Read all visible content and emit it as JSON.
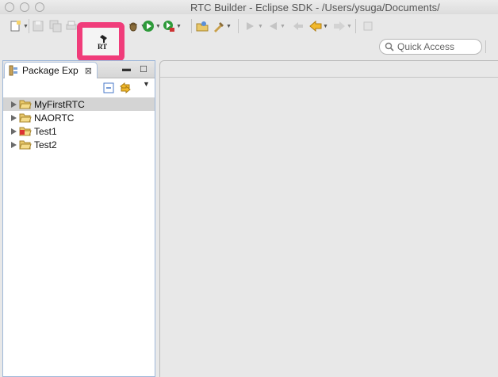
{
  "window": {
    "title": "RTC Builder - Eclipse SDK - /Users/ysuga/Documents/"
  },
  "toolbar": {
    "buttons": [
      {
        "icon": "new-wizard-icon",
        "enabled": true,
        "dropdown": true
      },
      {
        "icon": "save-icon",
        "enabled": false
      },
      {
        "icon": "save-all-icon",
        "enabled": false
      },
      {
        "icon": "print-icon",
        "enabled": false
      },
      {
        "icon": "rtc-builder-icon",
        "enabled": true,
        "label": "RT",
        "highlighted": true
      },
      {
        "icon": "debug-icon",
        "enabled": true,
        "dropdown": true
      },
      {
        "icon": "run-icon",
        "enabled": true,
        "dropdown": true
      },
      {
        "icon": "external-tools-icon",
        "enabled": true,
        "dropdown": true
      },
      {
        "icon": "open-type-icon",
        "enabled": true
      },
      {
        "icon": "open-task-icon",
        "enabled": true,
        "dropdown": true
      },
      {
        "icon": "next-annotation-icon",
        "enabled": false,
        "dropdown": true
      },
      {
        "icon": "previous-annotation-icon",
        "enabled": false,
        "dropdown": true
      },
      {
        "icon": "last-edit-location-icon",
        "enabled": false
      },
      {
        "icon": "back-icon",
        "enabled": true,
        "dropdown": true
      },
      {
        "icon": "forward-icon",
        "enabled": false,
        "dropdown": true
      },
      {
        "icon": "pin-editor-icon",
        "enabled": false
      }
    ],
    "highlight_color": "#f03c7a"
  },
  "quick_access": {
    "placeholder": "Quick Access"
  },
  "package_explorer": {
    "tab_label": "Package Exp",
    "tab_close": "⊠",
    "minimize": "▬",
    "maximize": "☐",
    "view_menu": "▼",
    "items": [
      {
        "label": "MyFirstRTC",
        "selected": true,
        "icon": "open-project-folder-icon"
      },
      {
        "label": "NAORTC",
        "selected": false,
        "icon": "open-project-folder-icon"
      },
      {
        "label": "Test1",
        "selected": false,
        "icon": "rtc-project-folder-icon"
      },
      {
        "label": "Test2",
        "selected": false,
        "icon": "open-project-folder-icon"
      }
    ]
  }
}
